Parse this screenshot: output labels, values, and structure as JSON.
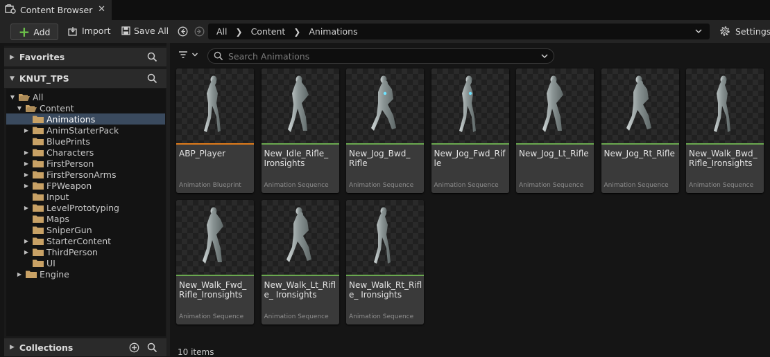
{
  "tab": {
    "title": "Content Browser",
    "close_glyph": "✕"
  },
  "toolbar": {
    "add_label": "Add",
    "import_label": "Import",
    "save_all_label": "Save All",
    "settings_label": "Settings"
  },
  "path": {
    "segments": [
      "All",
      "Content",
      "Animations"
    ]
  },
  "panels": {
    "favorites": "Favorites",
    "project": "KNUT_TPS",
    "collections": "Collections"
  },
  "tree": [
    {
      "label": "All",
      "depth": 0,
      "expand": "open",
      "selected": false
    },
    {
      "label": "Content",
      "depth": 1,
      "expand": "open",
      "selected": false
    },
    {
      "label": "Animations",
      "depth": 2,
      "expand": "none",
      "selected": true
    },
    {
      "label": "AnimStarterPack",
      "depth": 2,
      "expand": "closed",
      "selected": false
    },
    {
      "label": "BluePrints",
      "depth": 2,
      "expand": "none",
      "selected": false
    },
    {
      "label": "Characters",
      "depth": 2,
      "expand": "closed",
      "selected": false
    },
    {
      "label": "FirstPerson",
      "depth": 2,
      "expand": "closed",
      "selected": false
    },
    {
      "label": "FirstPersonArms",
      "depth": 2,
      "expand": "closed",
      "selected": false
    },
    {
      "label": "FPWeapon",
      "depth": 2,
      "expand": "closed",
      "selected": false
    },
    {
      "label": "Input",
      "depth": 2,
      "expand": "none",
      "selected": false
    },
    {
      "label": "LevelPrototyping",
      "depth": 2,
      "expand": "closed",
      "selected": false
    },
    {
      "label": "Maps",
      "depth": 2,
      "expand": "none",
      "selected": false
    },
    {
      "label": "SniperGun",
      "depth": 2,
      "expand": "none",
      "selected": false
    },
    {
      "label": "StarterContent",
      "depth": 2,
      "expand": "closed",
      "selected": false
    },
    {
      "label": "ThirdPerson",
      "depth": 2,
      "expand": "closed",
      "selected": false
    },
    {
      "label": "UI",
      "depth": 2,
      "expand": "none",
      "selected": false
    },
    {
      "label": "Engine",
      "depth": 1,
      "expand": "closed",
      "selected": false
    }
  ],
  "search": {
    "placeholder": "Search Animations"
  },
  "assets": [
    {
      "name": "ABP_Player",
      "type": "Animation Blueprint",
      "color": "#e07b1a"
    },
    {
      "name": "New_Idle_Rifle_ Ironsights",
      "type": "Animation Sequence",
      "color": "#6aa84f"
    },
    {
      "name": "New_Jog_Bwd_ Rifle",
      "type": "Animation Sequence",
      "color": "#6aa84f"
    },
    {
      "name": "New_Jog_Fwd_Rifle",
      "type": "Animation Sequence",
      "color": "#6aa84f"
    },
    {
      "name": "New_Jog_Lt_Rifle",
      "type": "Animation Sequence",
      "color": "#6aa84f"
    },
    {
      "name": "New_Jog_Rt_Rifle",
      "type": "Animation Sequence",
      "color": "#6aa84f"
    },
    {
      "name": "New_Walk_Bwd_ Rifle_Ironsights",
      "type": "Animation Sequence",
      "color": "#6aa84f"
    },
    {
      "name": "New_Walk_Fwd_ Rifle_Ironsights",
      "type": "Animation Sequence",
      "color": "#6aa84f"
    },
    {
      "name": "New_Walk_Lt_Rifle_ Ironsights",
      "type": "Animation Sequence",
      "color": "#6aa84f"
    },
    {
      "name": "New_Walk_Rt_Rifle_ Ironsights",
      "type": "Animation Sequence",
      "color": "#6aa84f"
    }
  ],
  "status": {
    "item_count": "10 items"
  },
  "colors": {
    "accent_add": "#6cc04a",
    "selection": "#3a4a5e",
    "folder": "#c8a165"
  },
  "icons": {
    "tab": "content-browser-icon",
    "settings": "gear-icon",
    "search": "search-icon",
    "filter": "filter-icon"
  }
}
